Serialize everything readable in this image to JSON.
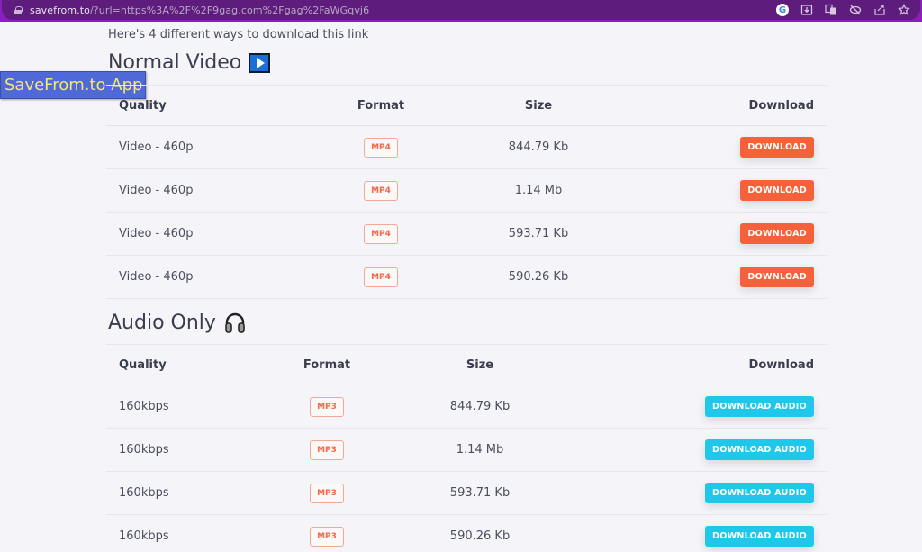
{
  "browser": {
    "url_domain": "savefrom.to",
    "url_rest": "/?url=https%3A%2F%2F9gag.com%2Fgag%2FaWGqvj6",
    "toolbar_icons": [
      "google-lens-icon",
      "install-app-icon",
      "translate-icon",
      "tracking-protection-icon",
      "share-icon",
      "bookmark-star-icon"
    ]
  },
  "page": {
    "intro": "Here's 4 different ways to download this link",
    "app_badge": "SaveFrom.to App"
  },
  "video": {
    "title": "Normal Video",
    "headers": {
      "quality": "Quality",
      "format": "Format",
      "size": "Size",
      "download": "Download"
    },
    "rows": [
      {
        "quality": "Video - 460p",
        "format": "MP4",
        "size": "844.79 Kb",
        "button": "DOWNLOAD"
      },
      {
        "quality": "Video - 460p",
        "format": "MP4",
        "size": "1.14 Mb",
        "button": "DOWNLOAD"
      },
      {
        "quality": "Video - 460p",
        "format": "MP4",
        "size": "593.71 Kb",
        "button": "DOWNLOAD"
      },
      {
        "quality": "Video - 460p",
        "format": "MP4",
        "size": "590.26 Kb",
        "button": "DOWNLOAD"
      }
    ]
  },
  "audio": {
    "title": "Audio Only",
    "headers": {
      "quality": "Quality",
      "format": "Format",
      "size": "Size",
      "download": "Download"
    },
    "rows": [
      {
        "quality": "160kbps",
        "format": "MP3",
        "size": "844.79 Kb",
        "button": "DOWNLOAD AUDIO"
      },
      {
        "quality": "160kbps",
        "format": "MP3",
        "size": "1.14 Mb",
        "button": "DOWNLOAD AUDIO"
      },
      {
        "quality": "160kbps",
        "format": "MP3",
        "size": "593.71 Kb",
        "button": "DOWNLOAD AUDIO"
      },
      {
        "quality": "160kbps",
        "format": "MP3",
        "size": "590.26 Kb",
        "button": "DOWNLOAD AUDIO"
      }
    ]
  },
  "colors": {
    "browser_frame": "#8a1fbf",
    "omnibox": "#5e1d7c",
    "video_button": "#f5613a",
    "audio_button": "#1fc8ea",
    "format_badge": "#f06a4b",
    "app_badge_bg": "#4f6ad8",
    "app_badge_text": "#f4e96b"
  }
}
